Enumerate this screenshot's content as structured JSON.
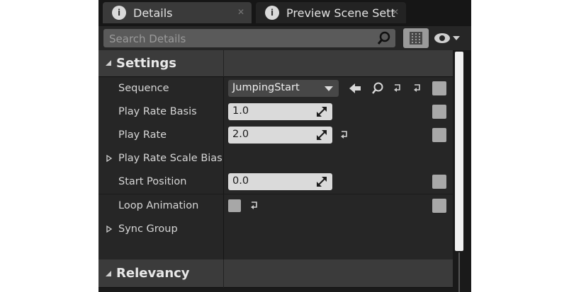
{
  "tabs": [
    {
      "label": "Details",
      "icon": "info-search-icon",
      "active": true
    },
    {
      "label": "Preview Scene Sett",
      "icon": "info-search-icon",
      "active": false
    }
  ],
  "search": {
    "placeholder": "Search Details"
  },
  "categories": {
    "settings": "Settings",
    "relevancy": "Relevancy"
  },
  "properties": {
    "sequence": {
      "label": "Sequence",
      "value": "JumpingStart"
    },
    "play_rate_basis": {
      "label": "Play Rate Basis",
      "value": "1.0"
    },
    "play_rate": {
      "label": "Play Rate",
      "value": "2.0"
    },
    "play_rate_scale_bias": {
      "label": "Play Rate Scale Bias C"
    },
    "start_position": {
      "label": "Start Position",
      "value": "0.0"
    },
    "loop_animation": {
      "label": "Loop Animation",
      "checked": false
    },
    "sync_group": {
      "label": "Sync Group"
    }
  },
  "colors": {
    "panel_bg": "#1a1a1a",
    "row_bg": "#262626",
    "category_bg": "#3b3b3b",
    "field_bg": "#dadada"
  }
}
